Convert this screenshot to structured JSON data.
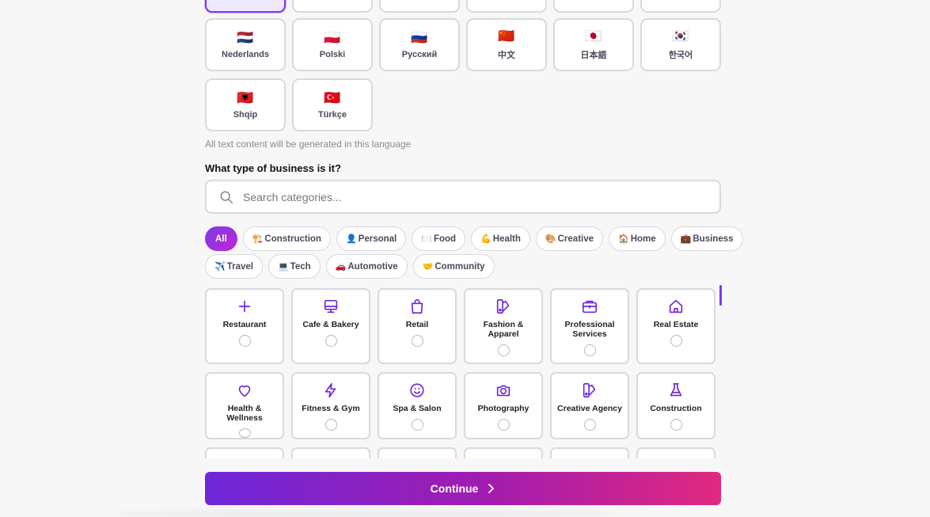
{
  "languages": {
    "row1_partial": [
      "",
      "",
      "",
      "",
      "",
      ""
    ],
    "row2": [
      {
        "flag": "🇳🇱",
        "name": "Nederlands"
      },
      {
        "flag": "🇵🇱",
        "name": "Polski"
      },
      {
        "flag": "🇷🇺",
        "name": "Русский"
      },
      {
        "flag": "🇨🇳",
        "name": "中文"
      },
      {
        "flag": "🇯🇵",
        "name": "日本語"
      },
      {
        "flag": "🇰🇷",
        "name": "한국어"
      }
    ],
    "row3": [
      {
        "flag": "🇦🇱",
        "name": "Shqip"
      },
      {
        "flag": "🇹🇷",
        "name": "Türkçe"
      }
    ],
    "hint": "All text content will be generated in this language"
  },
  "business": {
    "question": "What type of business is it?",
    "search_placeholder": "Search categories...",
    "chips_row1": [
      {
        "emoji": "",
        "label": "All"
      },
      {
        "emoji": "🏗️",
        "label": "Construction"
      },
      {
        "emoji": "👤",
        "label": "Personal"
      },
      {
        "emoji": "🍽️",
        "label": "Food"
      },
      {
        "emoji": "💪",
        "label": "Health"
      },
      {
        "emoji": "🎨",
        "label": "Creative"
      },
      {
        "emoji": "🏠",
        "label": "Home"
      },
      {
        "emoji": "💼",
        "label": "Business"
      }
    ],
    "chips_row2": [
      {
        "emoji": "✈️",
        "label": "Travel"
      },
      {
        "emoji": "💻",
        "label": "Tech"
      },
      {
        "emoji": "🚗",
        "label": "Automotive"
      },
      {
        "emoji": "🤝",
        "label": "Community"
      }
    ],
    "cards_row1": [
      {
        "icon": "plus-icon",
        "label": "Restaurant"
      },
      {
        "icon": "monitor-icon",
        "label": "Cafe & Bakery"
      },
      {
        "icon": "shopping-bag-icon",
        "label": "Retail"
      },
      {
        "icon": "palette-icon",
        "label": "Fashion & Apparel"
      },
      {
        "icon": "briefcase-icon",
        "label": "Professional Services"
      },
      {
        "icon": "house-icon",
        "label": "Real Estate"
      }
    ],
    "cards_row2": [
      {
        "icon": "heart-icon",
        "label": "Health & Wellness"
      },
      {
        "icon": "lightning-icon",
        "label": "Fitness & Gym"
      },
      {
        "icon": "smiley-icon",
        "label": "Spa & Salon"
      },
      {
        "icon": "camera-icon",
        "label": "Photography"
      },
      {
        "icon": "palette-icon",
        "label": "Creative Agency"
      },
      {
        "icon": "flask-icon",
        "label": "Construction"
      }
    ]
  },
  "continue_label": "Continue",
  "accent_color": "#7c3aed"
}
